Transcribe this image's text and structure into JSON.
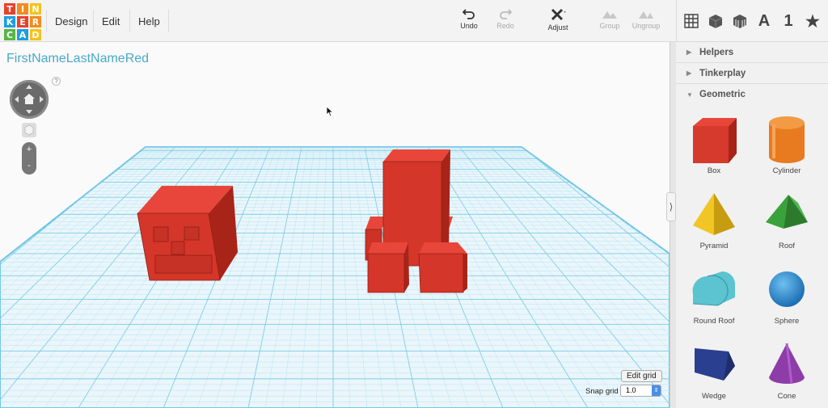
{
  "app": {
    "logo_letters": [
      "T",
      "I",
      "N",
      "K",
      "E",
      "R",
      "C",
      "A",
      "D"
    ],
    "logo_colors": [
      "#e8412c",
      "#f28b1e",
      "#f6c21c",
      "#1f9de0",
      "#e8412c",
      "#f28b1e",
      "#57b646",
      "#1f9de0",
      "#f6c21c"
    ]
  },
  "menu": {
    "design": "Design",
    "edit": "Edit",
    "help": "Help"
  },
  "toolbar": {
    "undo": "Undo",
    "redo": "Redo",
    "adjust": "Adjust",
    "group": "Group",
    "ungroup": "Ungroup"
  },
  "view_icons": [
    "grid-view-icon",
    "solid-box-icon",
    "striped-box-icon",
    "text-a-icon",
    "number-one-icon",
    "favorites-star-icon"
  ],
  "view_text": {
    "a": "A",
    "one": "1",
    "star": "★"
  },
  "workspace": {
    "project_title": "FirstNameLastNameRed",
    "help_q": "?",
    "zoom_in": "+",
    "zoom_out": "-",
    "edit_grid": "Edit grid",
    "snap_grid_label": "Snap grid",
    "snap_grid_value": "1.0"
  },
  "sidebar": {
    "sections": [
      {
        "label": "Helpers",
        "expanded": false,
        "arrow": "▶"
      },
      {
        "label": "Tinkerplay",
        "expanded": false,
        "arrow": "▶"
      },
      {
        "label": "Geometric",
        "expanded": true,
        "arrow": "▼"
      }
    ],
    "shapes": [
      {
        "label": "Box",
        "color": "#d63a2c"
      },
      {
        "label": "Cylinder",
        "color": "#e87b1f"
      },
      {
        "label": "Pyramid",
        "color": "#f1c524"
      },
      {
        "label": "Roof",
        "color": "#3aa23a"
      },
      {
        "label": "Round Roof",
        "color": "#5cc3d0"
      },
      {
        "label": "Sphere",
        "color": "#2d8fd6"
      },
      {
        "label": "Wedge",
        "color": "#2a3f8f"
      },
      {
        "label": "Cone",
        "color": "#8e3ca8"
      }
    ]
  },
  "colors": {
    "accent": "#4aa8c8",
    "object_red": "#d9362a",
    "grid_blue": "#8fd0e8"
  }
}
